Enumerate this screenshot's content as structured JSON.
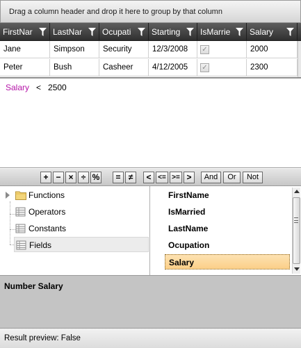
{
  "group_panel": {
    "hint": "Drag a column header and drop it here to group by that column"
  },
  "grid": {
    "columns": [
      {
        "label": "FirstNar"
      },
      {
        "label": "LastNar"
      },
      {
        "label": "Ocupati"
      },
      {
        "label": "Starting"
      },
      {
        "label": "IsMarrie"
      },
      {
        "label": "Salary"
      }
    ],
    "rows": [
      {
        "first_name": "Jane",
        "last_name": "Simpson",
        "ocupation": "Security",
        "starting": "12/3/2008",
        "is_married": true,
        "salary": "2000"
      },
      {
        "first_name": "Peter",
        "last_name": "Bush",
        "ocupation": "Casheer",
        "starting": "4/12/2005",
        "is_married": true,
        "salary": "2300"
      }
    ]
  },
  "filter": {
    "field": "Salary",
    "operator": "<",
    "value": "2500"
  },
  "toolbar": {
    "buttons": [
      "+",
      "−",
      "×",
      "÷",
      "%",
      "=",
      "≠",
      "<",
      "<=",
      ">=",
      ">",
      "And",
      "Or",
      "Not"
    ]
  },
  "tree": {
    "items": [
      {
        "label": "Functions",
        "icon": "folder-icon"
      },
      {
        "label": "Operators",
        "icon": "grid-icon"
      },
      {
        "label": "Constants",
        "icon": "grid-icon"
      },
      {
        "label": "Fields",
        "icon": "grid-icon"
      }
    ]
  },
  "fields_list": {
    "items": [
      "FirstName",
      "IsMarried",
      "LastName",
      "Ocupation",
      "Salary"
    ],
    "selected": "Salary"
  },
  "description": {
    "title": "Number Salary"
  },
  "status": {
    "text": "Result preview: False"
  },
  "colors": {
    "header_dark": "#2f2f2f",
    "field_highlight": "#b515a8",
    "selected_item": "#fbcf88"
  }
}
